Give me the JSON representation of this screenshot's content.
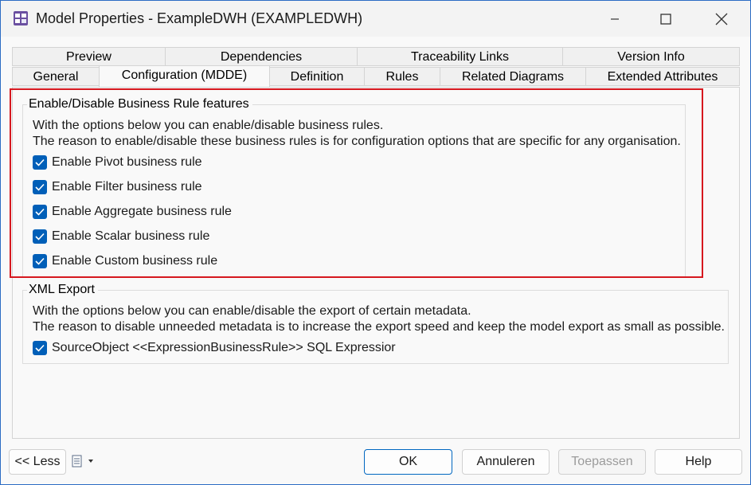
{
  "window": {
    "title": "Model Properties - ExampleDWH (EXAMPLEDWH)"
  },
  "tabs": {
    "row1": [
      {
        "label": "Preview"
      },
      {
        "label": "Dependencies"
      },
      {
        "label": "Traceability Links"
      },
      {
        "label": "Version Info"
      }
    ],
    "row2": [
      {
        "label": "General"
      },
      {
        "label": "Configuration (MDDE)",
        "active": true
      },
      {
        "label": "Definition"
      },
      {
        "label": "Rules"
      },
      {
        "label": "Related Diagrams"
      },
      {
        "label": "Extended Attributes"
      }
    ]
  },
  "business_rules": {
    "title": "Enable/Disable Business Rule features",
    "desc1": "With the options below you can enable/disable business rules.",
    "desc2": "The reason to enable/disable these business rules is for configuration options that are specific for any organisation.",
    "options": [
      {
        "label": "Enable Pivot business rule",
        "checked": true
      },
      {
        "label": "Enable Filter business rule",
        "checked": true
      },
      {
        "label": "Enable Aggregate business rule",
        "checked": true
      },
      {
        "label": "Enable Scalar business rule",
        "checked": true
      },
      {
        "label": "Enable Custom business rule",
        "checked": true
      }
    ]
  },
  "xml_export": {
    "title": "XML Export",
    "desc1": "With the options below you can enable/disable the export of certain metadata.",
    "desc2": "The reason to disable unneeded metadata is to increase the export speed and keep the model export as small as possible.",
    "options": [
      {
        "label": "SourceObject <<ExpressionBusinessRule>> SQL Expressior",
        "checked": true
      }
    ]
  },
  "footer": {
    "less_label": "<< Less",
    "menu_icon": "document-list-icon",
    "ok_label": "OK",
    "cancel_label": "Annuleren",
    "apply_label": "Toepassen",
    "help_label": "Help"
  },
  "colors": {
    "accent": "#005fb8",
    "highlight": "#d6181f",
    "window_border": "#2b6cc4"
  }
}
